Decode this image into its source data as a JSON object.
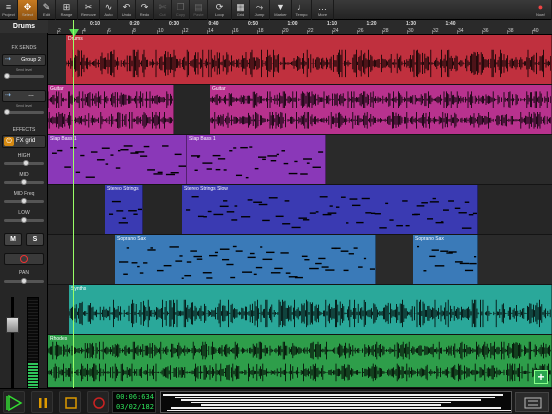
{
  "toolbar": {
    "items": [
      {
        "label": "Project",
        "icon": "≡",
        "state": "normal"
      },
      {
        "label": "Select",
        "icon": "✥",
        "state": "active"
      },
      {
        "label": "Edit",
        "icon": "✎",
        "state": "normal"
      },
      {
        "label": "Range",
        "icon": "⊞",
        "state": "normal"
      },
      {
        "label": "Remove",
        "icon": "✂",
        "state": "normal"
      },
      {
        "label": "Auto",
        "icon": "∿",
        "state": "normal"
      },
      {
        "label": "Undo",
        "icon": "↶",
        "state": "normal"
      },
      {
        "label": "Redo",
        "icon": "↷",
        "state": "normal"
      },
      {
        "label": "Cut",
        "icon": "✄",
        "state": "dim"
      },
      {
        "label": "Copy",
        "icon": "❐",
        "state": "dim"
      },
      {
        "label": "Paste",
        "icon": "▤",
        "state": "dim"
      },
      {
        "label": "Loop",
        "icon": "⟳",
        "state": "normal"
      },
      {
        "label": "Grid",
        "icon": "▦",
        "state": "normal"
      },
      {
        "label": "Jump",
        "icon": "⤳",
        "state": "normal"
      },
      {
        "label": "Marker",
        "icon": "▼",
        "state": "normal"
      },
      {
        "label": "Tempo",
        "icon": "♩",
        "state": "normal"
      },
      {
        "label": "More",
        "icon": "…",
        "state": "normal"
      }
    ],
    "right": {
      "label": "Now!",
      "icon": "●"
    }
  },
  "left_panel": {
    "track_name": "Drums",
    "fx_sends_title": "FX SENDS",
    "send1": {
      "name": "Group 2",
      "level_label": "Send level"
    },
    "send2": {
      "name": "---",
      "level_label": "Send level"
    },
    "effects_title": "EFFECTS",
    "fx": {
      "name": "FX grid"
    },
    "eq": [
      {
        "label": "HIGH",
        "value": 0.55
      },
      {
        "label": "MID",
        "value": 0.5
      },
      {
        "label": "MID Freq",
        "value": 0.5
      },
      {
        "label": "LOW",
        "value": 0.5
      }
    ],
    "mute_label": "M",
    "solo_label": "S",
    "pan_label": "PAN",
    "pan_value": 0.5,
    "fader_level": 0.75,
    "meter_level": 0.3
  },
  "ruler": {
    "bars": [
      "2",
      "4",
      "6",
      "8",
      "10",
      "12",
      "14",
      "16",
      "18",
      "20",
      "22",
      "24",
      "26",
      "28",
      "30",
      "32",
      "34",
      "36",
      "38",
      "40"
    ],
    "times": [
      "0:10",
      "0:20",
      "0:30",
      "0:40",
      "0:50",
      "1:00",
      "1:10",
      "1:20",
      "1:30",
      "1:40"
    ]
  },
  "tracks": [
    {
      "name": "Drums",
      "color": "#c0303e",
      "clips": [
        {
          "label": "Drums"
        }
      ]
    },
    {
      "name": "Guitar",
      "color": "#b8328e",
      "clips": [
        {
          "label": "Guitar"
        },
        {
          "label": "Guitar"
        }
      ]
    },
    {
      "name": "Slap Bass",
      "color": "#8a38b8",
      "clips": [
        {
          "label": "Slap Bass 1"
        },
        {
          "label": "Slap Bass 1"
        }
      ]
    },
    {
      "name": "Strings",
      "color": "#3a3ab2",
      "clips": [
        {
          "label": "Stereo Strings"
        },
        {
          "label": "Stereo Strings Slow"
        }
      ]
    },
    {
      "name": "Sax",
      "color": "#3a7ab8",
      "clips": [
        {
          "label": "Soprano Sax"
        },
        {
          "label": "Soprano Sax"
        }
      ]
    },
    {
      "name": "Synths",
      "color": "#2aa89a",
      "clips": [
        {
          "label": "Synths"
        }
      ]
    },
    {
      "name": "Rhodes",
      "color": "#2e9e4a",
      "clips": [
        {
          "label": "Rhodes"
        }
      ]
    }
  ],
  "transport": {
    "time": "00:06:634",
    "position": "03/02/182",
    "counter_color": "#2fe35b"
  }
}
